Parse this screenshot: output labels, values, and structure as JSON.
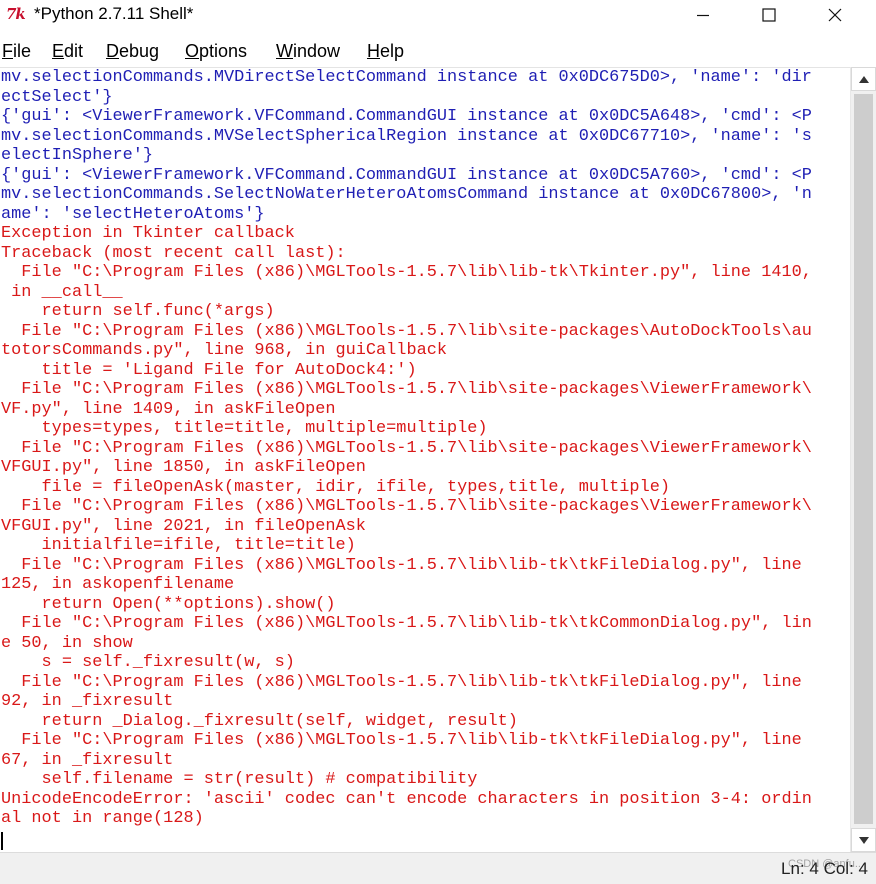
{
  "window": {
    "title": "*Python 2.7.11 Shell*",
    "icon": "tk-feather-icon"
  },
  "menu": [
    {
      "accel": "F",
      "rest": "ile"
    },
    {
      "accel": "E",
      "rest": "dit"
    },
    {
      "accel": "D",
      "rest": "ebug"
    },
    {
      "accel": "O",
      "rest": "ptions"
    },
    {
      "accel": "W",
      "rest": "indow"
    },
    {
      "accel": "H",
      "rest": "elp"
    }
  ],
  "colors": {
    "stdout": "#1f1fb4",
    "stderr": "#d91818"
  },
  "shell_lines": [
    {
      "t": "mv.selectionCommands.MVDirectSelectCommand instance at 0x0DC675D0>, 'name': 'dir",
      "s": "out"
    },
    {
      "t": "ectSelect'}",
      "s": "out"
    },
    {
      "t": "{'gui': <ViewerFramework.VFCommand.CommandGUI instance at 0x0DC5A648>, 'cmd': <P",
      "s": "out"
    },
    {
      "t": "mv.selectionCommands.MVSelectSphericalRegion instance at 0x0DC67710>, 'name': 's",
      "s": "out"
    },
    {
      "t": "electInSphere'}",
      "s": "out"
    },
    {
      "t": "{'gui': <ViewerFramework.VFCommand.CommandGUI instance at 0x0DC5A760>, 'cmd': <P",
      "s": "out"
    },
    {
      "t": "mv.selectionCommands.SelectNoWaterHeteroAtomsCommand instance at 0x0DC67800>, 'n",
      "s": "out"
    },
    {
      "t": "ame': 'selectHeteroAtoms'}",
      "s": "out"
    },
    {
      "t": "Exception in Tkinter callback",
      "s": "err"
    },
    {
      "t": "Traceback (most recent call last):",
      "s": "err"
    },
    {
      "t": "  File \"C:\\Program Files (x86)\\MGLTools-1.5.7\\lib\\lib-tk\\Tkinter.py\", line 1410,",
      "s": "err"
    },
    {
      "t": " in __call__",
      "s": "err"
    },
    {
      "t": "    return self.func(*args)",
      "s": "err"
    },
    {
      "t": "  File \"C:\\Program Files (x86)\\MGLTools-1.5.7\\lib\\site-packages\\AutoDockTools\\au",
      "s": "err"
    },
    {
      "t": "totorsCommands.py\", line 968, in guiCallback",
      "s": "err"
    },
    {
      "t": "    title = 'Ligand File for AutoDock4:')",
      "s": "err"
    },
    {
      "t": "  File \"C:\\Program Files (x86)\\MGLTools-1.5.7\\lib\\site-packages\\ViewerFramework\\",
      "s": "err"
    },
    {
      "t": "VF.py\", line 1409, in askFileOpen",
      "s": "err"
    },
    {
      "t": "    types=types, title=title, multiple=multiple)",
      "s": "err"
    },
    {
      "t": "  File \"C:\\Program Files (x86)\\MGLTools-1.5.7\\lib\\site-packages\\ViewerFramework\\",
      "s": "err"
    },
    {
      "t": "VFGUI.py\", line 1850, in askFileOpen",
      "s": "err"
    },
    {
      "t": "    file = fileOpenAsk(master, idir, ifile, types,title, multiple)",
      "s": "err"
    },
    {
      "t": "  File \"C:\\Program Files (x86)\\MGLTools-1.5.7\\lib\\site-packages\\ViewerFramework\\",
      "s": "err"
    },
    {
      "t": "VFGUI.py\", line 2021, in fileOpenAsk",
      "s": "err"
    },
    {
      "t": "    initialfile=ifile, title=title)",
      "s": "err"
    },
    {
      "t": "  File \"C:\\Program Files (x86)\\MGLTools-1.5.7\\lib\\lib-tk\\tkFileDialog.py\", line",
      "s": "err"
    },
    {
      "t": "125, in askopenfilename",
      "s": "err"
    },
    {
      "t": "    return Open(**options).show()",
      "s": "err"
    },
    {
      "t": "  File \"C:\\Program Files (x86)\\MGLTools-1.5.7\\lib\\lib-tk\\tkCommonDialog.py\", lin",
      "s": "err"
    },
    {
      "t": "e 50, in show",
      "s": "err"
    },
    {
      "t": "    s = self._fixresult(w, s)",
      "s": "err"
    },
    {
      "t": "  File \"C:\\Program Files (x86)\\MGLTools-1.5.7\\lib\\lib-tk\\tkFileDialog.py\", line",
      "s": "err"
    },
    {
      "t": "92, in _fixresult",
      "s": "err"
    },
    {
      "t": "    return _Dialog._fixresult(self, widget, result)",
      "s": "err"
    },
    {
      "t": "  File \"C:\\Program Files (x86)\\MGLTools-1.5.7\\lib\\lib-tk\\tkFileDialog.py\", line",
      "s": "err"
    },
    {
      "t": "67, in _fixresult",
      "s": "err"
    },
    {
      "t": "    self.filename = str(result) # compatibility",
      "s": "err"
    },
    {
      "t": "UnicodeEncodeError: 'ascii' codec can't encode characters in position 3-4: ordin",
      "s": "err"
    },
    {
      "t": "al not in range(128)",
      "s": "err"
    }
  ],
  "status": {
    "position": "Ln: 4  Col: 4",
    "watermark": "CSDN @anfu..."
  }
}
